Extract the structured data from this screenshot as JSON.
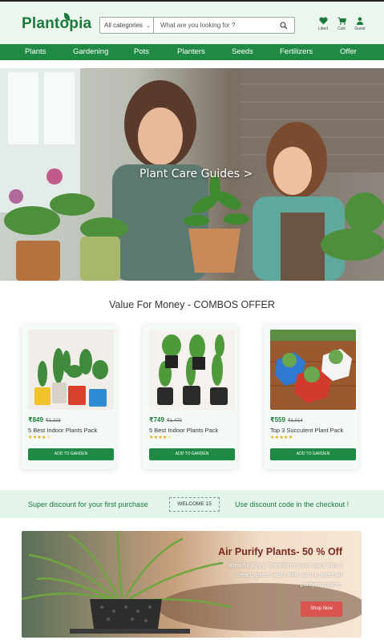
{
  "header": {
    "logo": "Plantopia",
    "search": {
      "category": "All categories",
      "placeholder": "What are you looking for ?"
    },
    "icons": [
      {
        "name": "heart-icon",
        "label": "Liked"
      },
      {
        "name": "cart-icon",
        "label": "Cart"
      },
      {
        "name": "user-icon",
        "label": "Guest"
      }
    ]
  },
  "nav": [
    "Plants",
    "Gardening",
    "Pots",
    "Planters",
    "Seeds",
    "Fertilizers",
    "Offer"
  ],
  "hero": {
    "title": "Plant Care Guides >"
  },
  "combos": {
    "title": "Value For Money - COMBOS OFFER",
    "items": [
      {
        "price": "₹849",
        "old_price": "₹1,223",
        "name": "5 Best Indoor Plants Pack",
        "stars": "★★★★☆",
        "button": "ADD TO GARDEN"
      },
      {
        "price": "₹749",
        "old_price": "₹1,470",
        "name": "5 Best Indoor Plants Pack",
        "stars": "★★★★☆",
        "button": "ADD TO GARDEN"
      },
      {
        "price": "₹559",
        "old_price": "₹1,014",
        "name": "Top 3 Succulent Plant Pack",
        "stars": "★★★★★",
        "button": "ADD TO GARDEN"
      }
    ]
  },
  "discount": {
    "left": "Super discount for your first purchase",
    "code": "WELCOME 15",
    "right": "Use discount code in the checkout !"
  },
  "promo": {
    "title": "Air Purify Plants- 50 % Off",
    "desc": "Breathe Easy. Transform your space into a clean, green oasis with our top-rated air purifying plants.",
    "button": "Shop Now"
  },
  "colors": {
    "brand": "#1e8a44",
    "header_bg": "#eaf6ee",
    "promo_button": "#d9534f",
    "promo_title": "#7a2a1e"
  }
}
